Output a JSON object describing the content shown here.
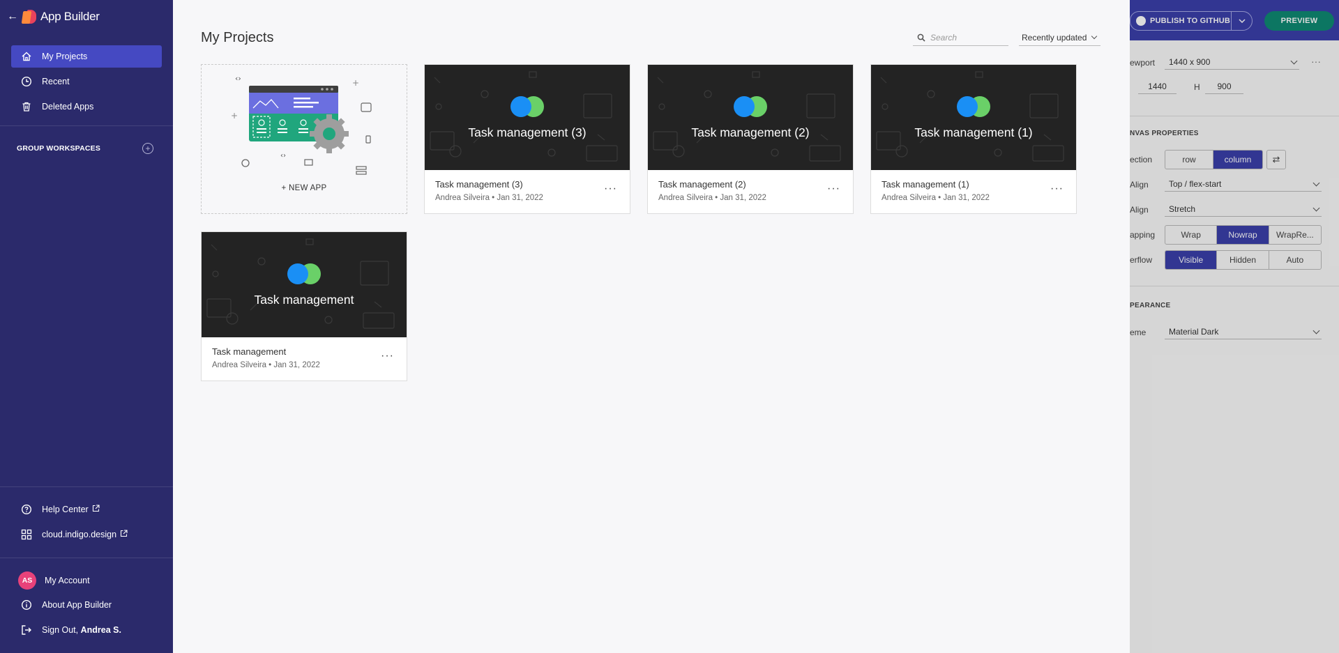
{
  "brand": {
    "title": "App Builder"
  },
  "sidebar": {
    "nav": [
      {
        "label": "My Projects",
        "icon": "home-icon"
      },
      {
        "label": "Recent",
        "icon": "clock-icon"
      },
      {
        "label": "Deleted Apps",
        "icon": "trash-icon"
      }
    ],
    "group_workspaces": "GROUP WORKSPACES",
    "links": [
      {
        "label": "Help Center",
        "icon": "help-icon"
      },
      {
        "label": "cloud.indigo.design",
        "icon": "grid-icon"
      }
    ],
    "account": {
      "avatar_initials": "AS",
      "my_account": "My Account",
      "about": "About App Builder",
      "sign_out_prefix": "Sign Out,",
      "sign_out_name": "Andrea S."
    }
  },
  "main": {
    "title": "My Projects",
    "search_placeholder": "Search",
    "sort_value": "Recently updated",
    "new_app_label": "+ NEW APP",
    "projects": [
      {
        "thumb_title": "Task management (3)",
        "name": "Task management (3)",
        "meta": "Andrea Silveira • Jan 31, 2022"
      },
      {
        "thumb_title": "Task management (2)",
        "name": "Task management (2)",
        "meta": "Andrea Silveira • Jan 31, 2022"
      },
      {
        "thumb_title": "Task management (1)",
        "name": "Task management (1)",
        "meta": "Andrea Silveira • Jan 31, 2022"
      },
      {
        "thumb_title": "Task management",
        "name": "Task management",
        "meta": "Andrea Silveira • Jan 31, 2022"
      }
    ],
    "more_glyph": "···"
  },
  "panel": {
    "publish_label": "PUBLISH TO GITHUB",
    "preview_label": "PREVIEW",
    "viewport_label": "ewport",
    "viewport_value": "1440 x 900",
    "width_value": "1440",
    "height_label": "H",
    "height_value": "900",
    "canvas_title": "NVAS PROPERTIES",
    "direction_label": "ection",
    "direction_options": [
      "row",
      "column"
    ],
    "direction_selected": "column",
    "align1_label": "Align",
    "align1_value": "Top / flex-start",
    "align2_label": "Align",
    "align2_value": "Stretch",
    "wrap_label": "apping",
    "wrap_options": [
      "Wrap",
      "Nowrap",
      "WrapRe..."
    ],
    "wrap_selected": "Nowrap",
    "overflow_label": "erflow",
    "overflow_options": [
      "Visible",
      "Hidden",
      "Auto"
    ],
    "overflow_selected": "Visible",
    "appearance_title": "PEARANCE",
    "theme_label": "eme",
    "theme_value": "Material Dark"
  },
  "colors": {
    "sidebar_bg": "#2b2a6b",
    "active_nav": "#4549c2",
    "panel_topbar": "#3b3fab",
    "preview_btn": "#0e8a73",
    "avatar": "#e8427a",
    "thumb_bg": "#232323",
    "dot_blue": "#1a8ff5",
    "dot_green": "#6ad068"
  }
}
